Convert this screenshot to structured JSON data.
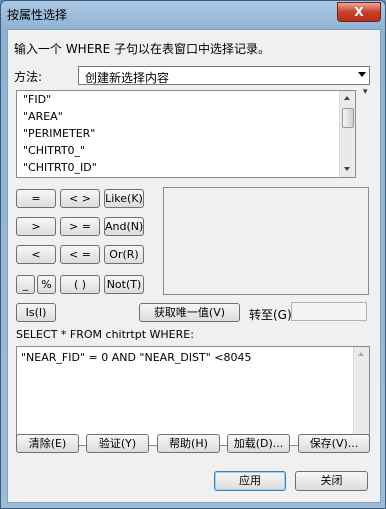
{
  "window": {
    "title": "按属性选择",
    "close_glyph": "X"
  },
  "instruction": "输入一个 WHERE 子句以在表窗口中选择记录。",
  "method": {
    "label": "方法:",
    "selected": "创建新选择内容"
  },
  "fields": [
    "\"FID\"",
    "\"AREA\"",
    "\"PERIMETER\"",
    "\"CHITRT0_\"",
    "\"CHITRT0_ID\""
  ],
  "operators": {
    "eq": "=",
    "ne": "< >",
    "like": "Like(K)",
    "gt": ">",
    "ge": "> =",
    "and": "And(N)",
    "lt": "<",
    "le": "< =",
    "or": "Or(R)",
    "underscore": "_",
    "percent": "%",
    "parens": "( )",
    "not": "Not(T)",
    "is": "Is(I)"
  },
  "unique_button": "获取唯一值(V)",
  "goto_label": "转至(G):",
  "sql": {
    "label": "SELECT * FROM chitrtpt WHERE:",
    "expression": "\"NEAR_FID\" = 0 AND \"NEAR_DIST\" <8045"
  },
  "actions": {
    "clear": "清除(E)",
    "verify": "验证(Y)",
    "help": "帮助(H)",
    "load": "加载(D)...",
    "save": "保存(V)..."
  },
  "footer": {
    "apply": "应用",
    "close": "关闭"
  }
}
